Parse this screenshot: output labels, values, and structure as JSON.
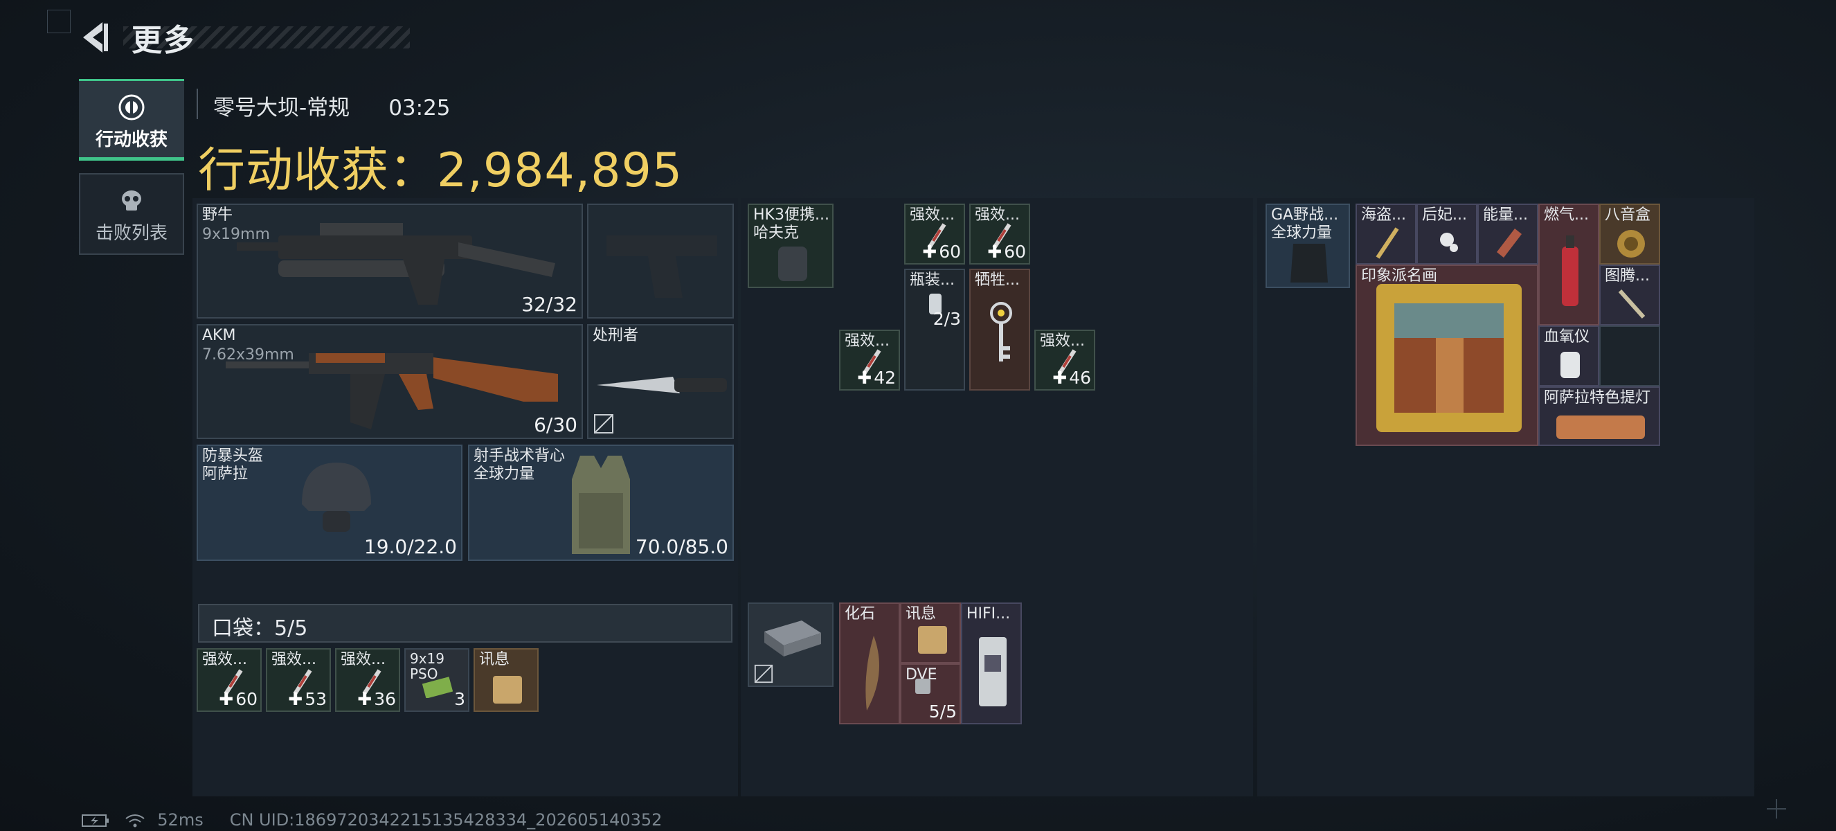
{
  "header": {
    "title": "更多"
  },
  "tabs": [
    {
      "label": "行动收获",
      "active": true
    },
    {
      "label": "击败列表",
      "active": false
    }
  ],
  "match": {
    "map": "零号大坝-常规",
    "time": "03:25"
  },
  "haul": {
    "label": "行动收获：",
    "value": "2,984,895"
  },
  "loadout": {
    "primary": {
      "name": "野牛",
      "caliber": "9x19mm",
      "ammo": "32/32"
    },
    "secondary": {
      "name": "AKM",
      "caliber": "7.62x39mm",
      "ammo": "6/30"
    },
    "melee": {
      "name": "处刑者"
    },
    "helmet": {
      "name": "防暴头盔",
      "brand": "阿萨拉",
      "durability": "19.0/22.0"
    },
    "armor": {
      "name": "射手战术背心",
      "brand": "全球力量",
      "durability": "70.0/85.0"
    }
  },
  "pockets": {
    "label": "口袋：",
    "count": "5/5",
    "items": [
      {
        "name": "强效...",
        "value": "60"
      },
      {
        "name": "强效...",
        "value": "53"
      },
      {
        "name": "强效...",
        "value": "36"
      },
      {
        "name": "9x19 PSO",
        "value": "3"
      },
      {
        "name": "讯息",
        "value": ""
      }
    ]
  },
  "middle": {
    "hk3": {
      "name": "HK3便携...",
      "brand": "哈夫克"
    },
    "grid": [
      {
        "name": "强效...",
        "value": "60"
      },
      {
        "name": "强效...",
        "value": "60"
      },
      {
        "name": "瓶装...",
        "value": "2/3"
      },
      {
        "name": "牺牲...",
        "value": ""
      },
      {
        "name": "强效...",
        "value": "42"
      },
      {
        "name": "强效...",
        "value": "46"
      }
    ],
    "bottom": [
      {
        "name": "化石",
        "value": ""
      },
      {
        "name": "讯息",
        "value": ""
      },
      {
        "name": "HIFI...",
        "value": ""
      },
      {
        "name": "DVE",
        "value": "5/5"
      }
    ]
  },
  "right": {
    "rig": {
      "name": "GA野战...",
      "brand": "全球力量"
    },
    "items": [
      {
        "name": "海盗..."
      },
      {
        "name": "后妃..."
      },
      {
        "name": "能量..."
      },
      {
        "name": "燃气..."
      },
      {
        "name": "八音盒"
      },
      {
        "name": "印象派名画"
      },
      {
        "name": "图腾..."
      },
      {
        "name": "血氧仪"
      },
      {
        "name": "阿萨拉特色提灯"
      }
    ]
  },
  "footer": {
    "ping": "52ms",
    "uid": "CN UID:1869720342215135428334_202605140352"
  }
}
